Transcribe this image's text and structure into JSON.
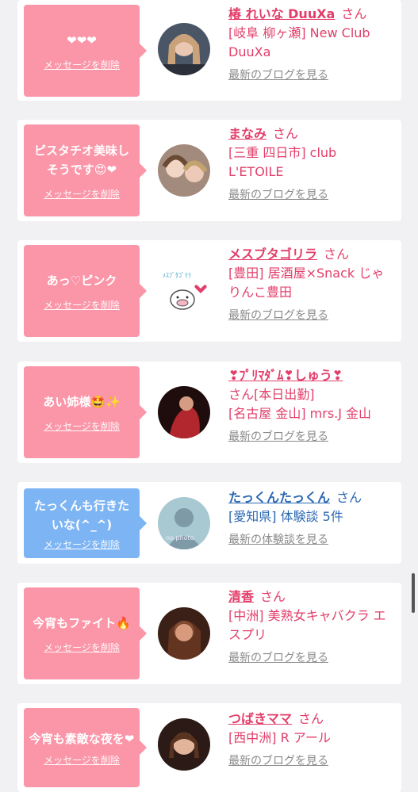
{
  "items": [
    {
      "message": "❤❤❤",
      "delete_label": "メッセージを削除",
      "name": "椿 れいな DuuXa",
      "san": "さん",
      "shop": "[岐阜 柳ヶ瀬] New Club DuuXa",
      "blog": "最新のブログを見る",
      "theme": "pink"
    },
    {
      "message": "ピスタチオ美味しそうです😍❤",
      "delete_label": "メッセージを削除",
      "name": "まなみ",
      "san": "さん",
      "shop": "[三重 四日市] club L'ETOILE",
      "blog": "最新のブログを見る",
      "theme": "pink"
    },
    {
      "message": "あっ♡ピンク",
      "delete_label": "メッセージを削除",
      "name": "メスブタゴリラ",
      "san": "さん",
      "shop": "[豊田] 居酒屋×Snack じゃりんこ豊田",
      "blog": "最新のブログを見る",
      "theme": "pink"
    },
    {
      "message": "あい姉様🤩✨",
      "delete_label": "メッセージを削除",
      "name": "❣ﾌﾟﾘﾏﾀﾞﾑ❣しゅう❣",
      "san": "さん[本日出勤]",
      "shop": "[名古屋 金山] mrs.J 金山",
      "blog": "最新のブログを見る",
      "theme": "pink"
    },
    {
      "message": "たっくんも行きたいな(^_^)",
      "delete_label": "メッセージを削除",
      "name": "たっくんたっくん",
      "san": "さん",
      "shop": "[愛知県] 体験談 5件",
      "blog": "最新の体験談を見る",
      "theme": "blue",
      "avatar_text": "no photo"
    },
    {
      "message": "今宵もファイト🔥",
      "delete_label": "メッセージを削除",
      "name": "清香",
      "san": "さん",
      "shop": "[中洲] 美熟女キャバクラ エスプリ",
      "blog": "最新のブログを見る",
      "theme": "pink"
    },
    {
      "message": "今宵も素敵な夜を❤",
      "delete_label": "メッセージを削除",
      "name": "つばきママ",
      "san": "さん",
      "shop": "[西中洲] R アール",
      "blog": "最新のブログを見る",
      "theme": "pink"
    }
  ],
  "colors": {
    "pink_bubble": "#fb95a8",
    "blue_bubble": "#7db4f4",
    "name_pink": "#e23e6a",
    "name_blue": "#2b68b3"
  }
}
